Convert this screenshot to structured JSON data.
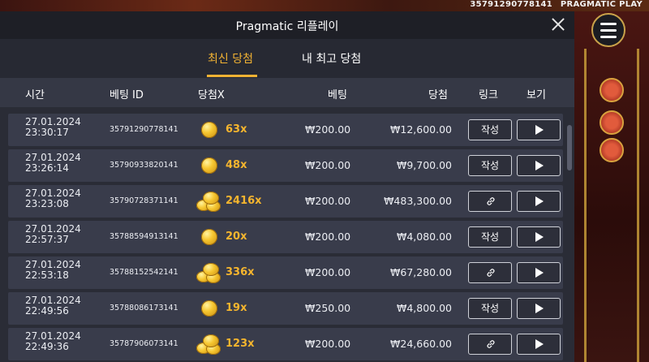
{
  "background": {
    "top_id": "35791290778141",
    "brand": "PRAGMATIC PLAY"
  },
  "modal": {
    "title": "Pragmatic 리플레이"
  },
  "tabs": [
    {
      "label": "최신 당첨",
      "active": true
    },
    {
      "label": "내 최고 당첨",
      "active": false
    }
  ],
  "columns": {
    "time": "시간",
    "bet_id": "베팅 ID",
    "multiplier": "당첨X",
    "bet": "베팅",
    "win": "당첨",
    "link": "링크",
    "view": "보기"
  },
  "rows": [
    {
      "date": "27.01.2024",
      "time": "23:30:17",
      "bet_id": "35791290778141",
      "mult": "63x",
      "bet": "₩200.00",
      "win": "₩12,600.00",
      "link": "작성",
      "coins": "single"
    },
    {
      "date": "27.01.2024",
      "time": "23:26:14",
      "bet_id": "35790933820141",
      "mult": "48x",
      "bet": "₩200.00",
      "win": "₩9,700.00",
      "link": "작성",
      "coins": "single"
    },
    {
      "date": "27.01.2024",
      "time": "23:23:08",
      "bet_id": "35790728371141",
      "mult": "2416x",
      "bet": "₩200.00",
      "win": "₩483,300.00",
      "link": "",
      "coins": "pile"
    },
    {
      "date": "27.01.2024",
      "time": "22:57:37",
      "bet_id": "35788594913141",
      "mult": "20x",
      "bet": "₩200.00",
      "win": "₩4,080.00",
      "link": "작성",
      "coins": "single"
    },
    {
      "date": "27.01.2024",
      "time": "22:53:18",
      "bet_id": "35788152542141",
      "mult": "336x",
      "bet": "₩200.00",
      "win": "₩67,280.00",
      "link": "",
      "coins": "pile"
    },
    {
      "date": "27.01.2024",
      "time": "22:49:56",
      "bet_id": "35788086173141",
      "mult": "19x",
      "bet": "₩250.00",
      "win": "₩4,800.00",
      "link": "작성",
      "coins": "single"
    },
    {
      "date": "27.01.2024",
      "time": "22:49:36",
      "bet_id": "35787906073141",
      "mult": "123x",
      "bet": "₩200.00",
      "win": "₩24,660.00",
      "link": "",
      "coins": "pile"
    }
  ],
  "colors": {
    "accent": "#f2b233",
    "panel": "#2a2c36",
    "row": "#393c4b"
  }
}
